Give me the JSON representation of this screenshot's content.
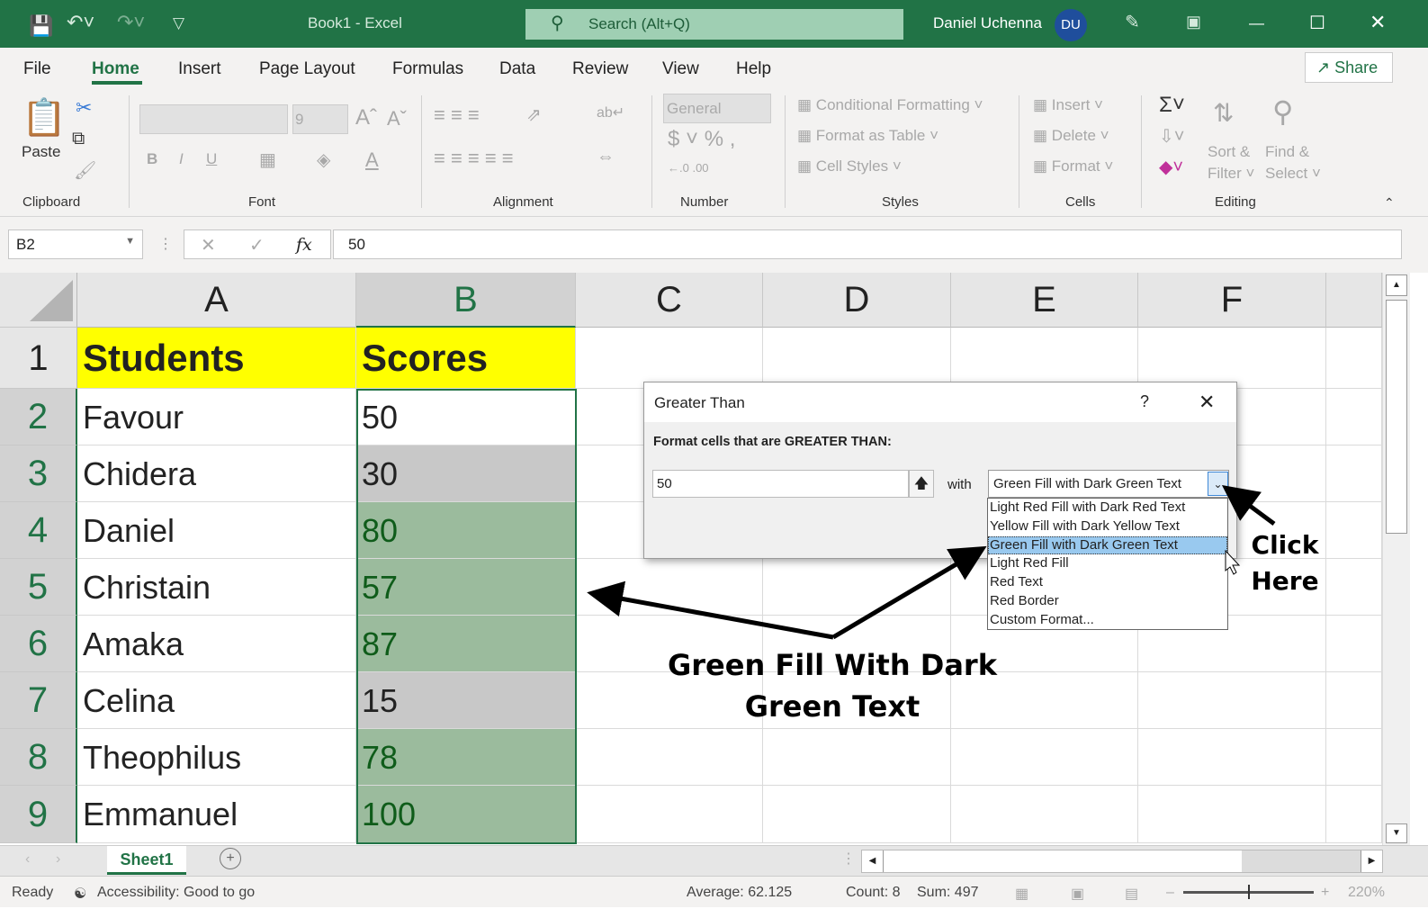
{
  "titlebar": {
    "title": "Book1  -  Excel",
    "search_placeholder": "Search (Alt+Q)",
    "user": "Daniel Uchenna",
    "initials": "DU"
  },
  "tabs": [
    "File",
    "Home",
    "Insert",
    "Page Layout",
    "Formulas",
    "Data",
    "Review",
    "View",
    "Help"
  ],
  "share": "Share",
  "ribbon": {
    "clipboard": {
      "label": "Clipboard",
      "paste": "Paste"
    },
    "font": {
      "label": "Font",
      "size": "9",
      "bold": "B",
      "italic": "I",
      "underline": "U"
    },
    "alignment": {
      "label": "Alignment"
    },
    "number": {
      "label": "Number",
      "format": "General"
    },
    "styles": {
      "label": "Styles",
      "conditional": "Conditional Formatting",
      "table": "Format as Table",
      "cell": "Cell Styles"
    },
    "cells": {
      "label": "Cells",
      "insert": "Insert",
      "delete": "Delete",
      "format": "Format"
    },
    "editing": {
      "label": "Editing",
      "sort1": "Sort &",
      "sort2": "Filter",
      "find1": "Find &",
      "find2": "Select"
    }
  },
  "formula_bar": {
    "name_box": "B2",
    "fx": "fx",
    "value": "50"
  },
  "columns": [
    "A",
    "B",
    "C",
    "D",
    "E",
    "F"
  ],
  "rows": [
    {
      "n": "1",
      "a": "Students",
      "b": "Scores",
      "style": "header"
    },
    {
      "n": "2",
      "a": "Favour",
      "b": "50",
      "style": "none"
    },
    {
      "n": "3",
      "a": "Chidera",
      "b": "30",
      "style": "grey"
    },
    {
      "n": "4",
      "a": "Daniel",
      "b": "80",
      "style": "green"
    },
    {
      "n": "5",
      "a": "Christain",
      "b": "57",
      "style": "green"
    },
    {
      "n": "6",
      "a": "Amaka",
      "b": "87",
      "style": "green"
    },
    {
      "n": "7",
      "a": "Celina",
      "b": "15",
      "style": "grey"
    },
    {
      "n": "8",
      "a": "Theophilus",
      "b": "78",
      "style": "green"
    },
    {
      "n": "9",
      "a": "Emmanuel",
      "b": "100",
      "style": "green"
    }
  ],
  "colors": {
    "brand": "#217346",
    "header_fill": "#ffff00",
    "green_fill": "#9bbb9d",
    "green_text": "#0f5c1a",
    "grey_fill": "#c8c8c8"
  },
  "sheet_tab": "Sheet1",
  "status": {
    "ready": "Ready",
    "accessibility": "Accessibility: Good to go",
    "average": "Average: 62.125",
    "count": "Count: 8",
    "sum": "Sum: 497",
    "zoom": "220%"
  },
  "dialog": {
    "title": "Greater Than",
    "help": "?",
    "prompt": "Format cells that are GREATER THAN:",
    "value": "50",
    "with": "with",
    "selected": "Green Fill with Dark Green Text",
    "options": [
      "Light Red Fill with Dark Red Text",
      "Yellow Fill with Dark Yellow Text",
      "Green Fill with Dark Green Text",
      "Light Red Fill",
      "Red Text",
      "Red Border",
      "Custom Format..."
    ],
    "highlighted_index": 2
  },
  "annotations": {
    "click_line1": "Click",
    "click_line2": "Here",
    "green_line1": "Green Fill With Dark",
    "green_line2": "Green Text"
  }
}
